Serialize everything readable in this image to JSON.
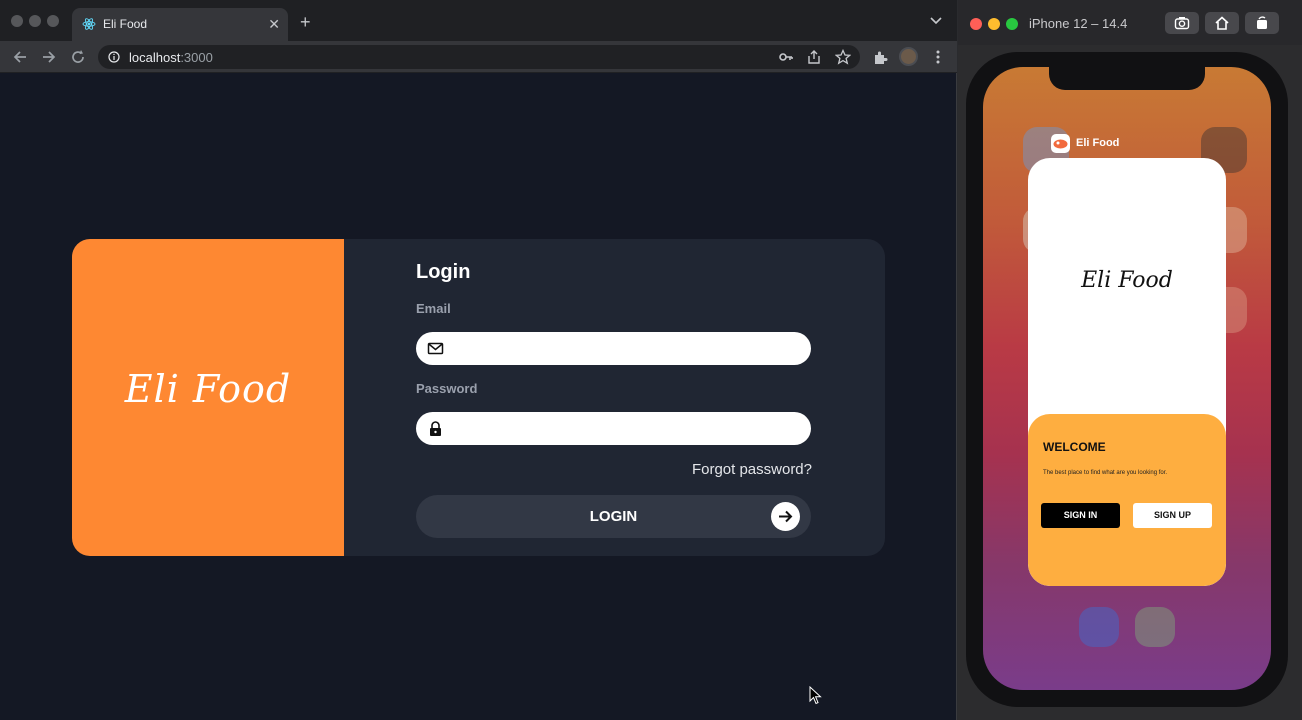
{
  "browser": {
    "tab_title": "Eli Food",
    "url_host": "localhost",
    "url_port": ":3000",
    "icons": [
      "back-icon",
      "forward-icon",
      "reload-icon",
      "info-icon",
      "key-icon",
      "share-icon",
      "star-icon",
      "extensions-icon",
      "menu-icon"
    ]
  },
  "login": {
    "brand": "Eli Food",
    "title": "Login",
    "email_label": "Email",
    "email_value": "",
    "password_label": "Password",
    "password_value": "",
    "forgot": "Forgot password?",
    "button": "LOGIN"
  },
  "simulator": {
    "title": "iPhone 12 – 14.4",
    "app_name": "Eli Food",
    "app_logo": "Eli Food",
    "welcome_title": "WELCOME",
    "welcome_subtitle": "The best place to find what are you looking for.",
    "signin": "SIGN IN",
    "signup": "SIGN UP"
  },
  "colors": {
    "brand_orange": "#fe8832",
    "card_bg": "#202633",
    "page_bg": "#141824",
    "mobile_panel": "#feae40"
  }
}
